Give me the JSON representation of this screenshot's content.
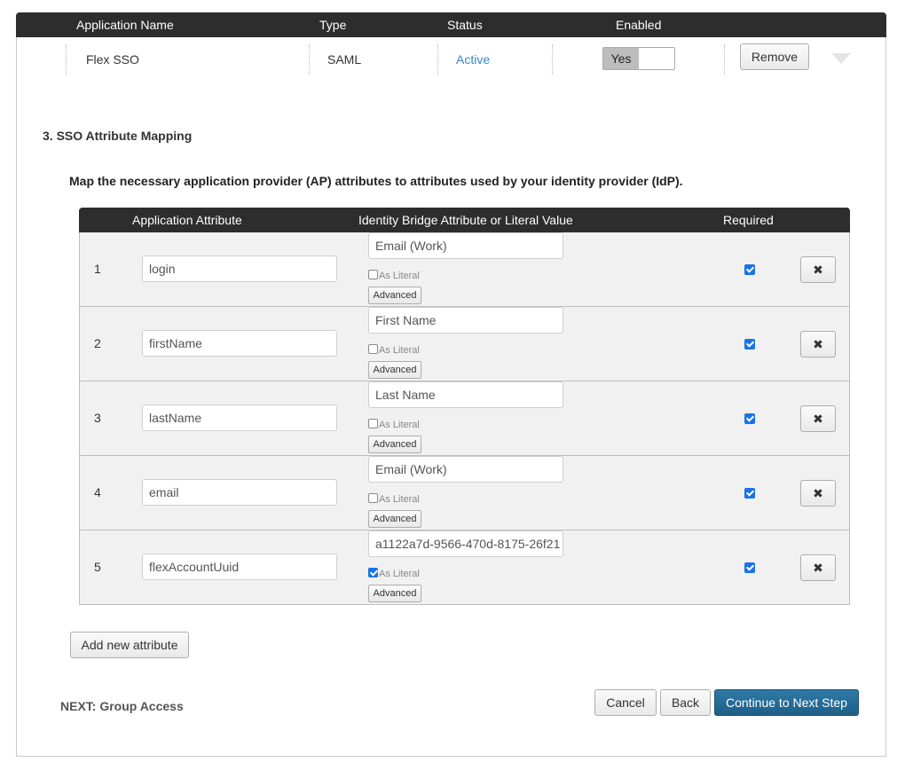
{
  "app_table": {
    "headers": {
      "name": "Application Name",
      "type": "Type",
      "status": "Status",
      "enabled": "Enabled"
    },
    "row": {
      "name": "Flex SSO",
      "type": "SAML",
      "status": "Active",
      "status_color": "#3a87c8",
      "enabled_toggle": "Yes",
      "remove_label": "Remove"
    }
  },
  "section": {
    "title": "3. SSO Attribute Mapping",
    "intro": "Map the necessary application provider (AP) attributes to attributes used by your identity provider (IdP)."
  },
  "mapping": {
    "headers": {
      "app_attr": "Application Attribute",
      "idb_attr": "Identity Bridge Attribute or Literal Value",
      "required": "Required"
    },
    "as_literal_label": "As Literal",
    "advanced_label": "Advanced",
    "delete_icon": "✖",
    "rows": [
      {
        "num": "1",
        "app_attr": "login",
        "idb_attr": "Email (Work)",
        "as_literal": false,
        "required": true
      },
      {
        "num": "2",
        "app_attr": "firstName",
        "idb_attr": "First Name",
        "as_literal": false,
        "required": true
      },
      {
        "num": "3",
        "app_attr": "lastName",
        "idb_attr": "Last Name",
        "as_literal": false,
        "required": true
      },
      {
        "num": "4",
        "app_attr": "email",
        "idb_attr": "Email (Work)",
        "as_literal": false,
        "required": true
      },
      {
        "num": "5",
        "app_attr": "flexAccountUuid",
        "idb_attr": "a1122a7d-9566-470d-8175-26f21",
        "as_literal": true,
        "required": true
      }
    ]
  },
  "footer": {
    "add_attribute": "Add new attribute",
    "next_label": "NEXT: Group Access",
    "cancel": "Cancel",
    "back": "Back",
    "continue": "Continue to Next Step"
  },
  "colors": {
    "header_bg": "#2d2d2d",
    "primary_button": "#2a6f9a",
    "checkbox_checked": "#1a73e8"
  }
}
